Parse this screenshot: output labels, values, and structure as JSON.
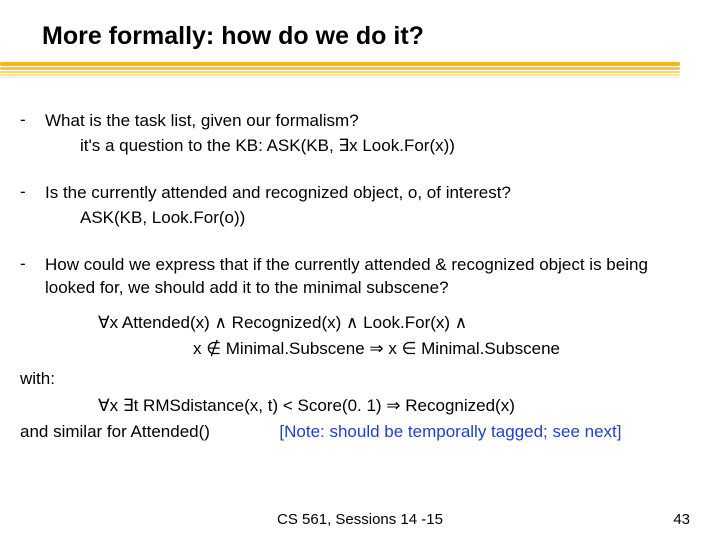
{
  "title": "More formally: how do we do it?",
  "items": [
    {
      "q": "What is the task list, given our formalism?",
      "a": "it's a question to the KB:  ASK(KB, ∃x  Look.For(x))"
    },
    {
      "q": "Is the currently attended and recognized object, o, of interest?",
      "a": "ASK(KB, Look.For(o))"
    },
    {
      "q": "How could we express that if the currently attended & recognized object is being looked for, we should add it to the minimal subscene?"
    }
  ],
  "formula": {
    "l1": "∀x  Attended(x) ∧ Recognized(x) ∧ Look.For(x) ∧",
    "l2": "x ∉ Minimal.Subscene ⇒ x ∈ Minimal.Subscene"
  },
  "with_label": "with:",
  "with_formula": "∀x ∃t  RMSdistance(x, t) < Score(0. 1) ⇒ Recognized(x)",
  "similar": "and similar for Attended()",
  "note": "[Note: should be temporally tagged; see next]",
  "footer": "CS 561,  Sessions 14 -15",
  "page": "43"
}
